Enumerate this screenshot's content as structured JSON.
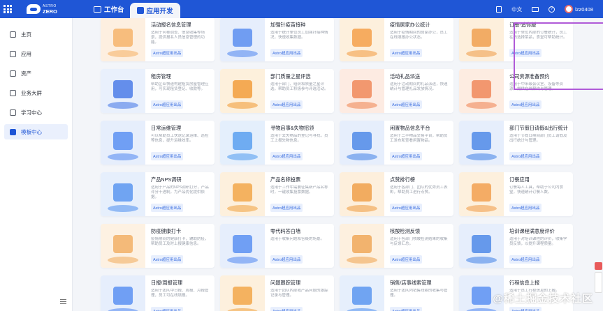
{
  "header": {
    "brand_top": "ASTRO",
    "brand_bottom": "ZERO",
    "tabs": [
      {
        "label": "工作台",
        "active": false
      },
      {
        "label": "应用开发",
        "active": true
      }
    ],
    "right": {
      "doc_label": "",
      "lang": "中文",
      "user": "lzz0408"
    }
  },
  "sidebar": {
    "items": [
      {
        "label": "主页",
        "icon": "home-icon",
        "active": false
      },
      {
        "label": "应用",
        "icon": "app-icon",
        "active": false
      },
      {
        "label": "资产",
        "icon": "asset-icon",
        "active": false
      },
      {
        "label": "业务大屏",
        "icon": "screen-icon",
        "active": false
      },
      {
        "label": "学习中心",
        "icon": "learn-icon",
        "active": false
      },
      {
        "label": "模板中心",
        "icon": "template-icon",
        "active": true
      }
    ]
  },
  "cards": [
    {
      "title": "活动报名信息管理",
      "desc": "适用于问卷调查、信息收集等场景，提供报名人员信息管理的功能。",
      "tag": "Astro超应用出品",
      "color": "#f6b46b",
      "bg": "#fdefe0"
    },
    {
      "title": "加强针疫苗接种",
      "desc": "适用于统计单位员工加强针接种情况，快速收集数据。",
      "tag": "Astro超应用出品",
      "color": "#5a8ef0",
      "bg": "#e6eefc"
    },
    {
      "title": "疫情居家办公统计",
      "desc": "适用于疫情期间的居家办公，员工在线填报办公状态。",
      "tag": "Astro超应用出品",
      "color": "#f4a04a",
      "bg": "#fdf0dd"
    },
    {
      "title": "订餐-追你版",
      "desc": "适用于单位内部的订餐统计，员工在线选择菜品，食堂可帮助统计。",
      "tag": "Astro超应用出品",
      "color": "#f0a050",
      "bg": "#fdefdc"
    },
    {
      "title": "租房管理",
      "desc": "帮助企业快速构建租赁房屋管理应用，可实现租赁登记、收款等。",
      "tag": "Astro超应用出品",
      "color": "#4c7de8",
      "bg": "#e9f0fc"
    },
    {
      "title": "部门质量之星评选",
      "desc": "适用于部门、组织和质量之星评选，帮助员工积极参与评选活动。",
      "tag": "Astro超应用出品",
      "color": "#f29e3c",
      "bg": "#fdf0dc"
    },
    {
      "title": "活动礼品派送",
      "desc": "适用于活动期间的礼品派送，快速统计与管理礼品发放情况。",
      "tag": "Astro超应用出品",
      "color": "#f08a5a",
      "bg": "#fdebe2"
    },
    {
      "title": "公司资源准备预约",
      "desc": "适用于中米级会议室、设备等资源，提供在线预约与管理。",
      "tag": "Astro超应用出品",
      "color": "#f0885a",
      "bg": "#fdece1"
    },
    {
      "title": "日常运维管理",
      "desc": "可以帮助员工快速记录运维、巡检等信息，提升运维效率。",
      "tag": "Astro超应用出品",
      "color": "#5b90f2",
      "bg": "#e6eefc"
    },
    {
      "title": "寻物启事&失物招领",
      "desc": "适用于丢失物品的登记与寻找，员工上报失物信息。",
      "tag": "Astro超应用出品",
      "color": "#5aa0f0",
      "bg": "#e4effc"
    },
    {
      "title": "闲置物品信息平台",
      "desc": "适用于二手物品交易平台，帮助员工发布和查看闲置物品。",
      "tag": "Astro超应用出品",
      "color": "#4f8ae8",
      "bg": "#e6eefc"
    },
    {
      "title": "部门节假日请假&出行统计",
      "desc": "适用于节假日期间部门员工请假及出行统计与管理。",
      "tag": "Astro超应用出品",
      "color": "#4f8ae8",
      "bg": "#e6eefc"
    },
    {
      "title": "产品NPS调研",
      "desc": "适用于产品的NPS调研打分，产品评分十进制，为产品优化提供依据。",
      "tag": "Astro超应用出品",
      "color": "#5a96f0",
      "bg": "#e6effc"
    },
    {
      "title": "产品名称投票",
      "desc": "适用于工作中需要征集新产品名称时，一键收集投票数据。",
      "tag": "Astro超应用出品",
      "color": "#f2a74a",
      "bg": "#fdf0dd"
    },
    {
      "title": "点赞排行榜",
      "desc": "适用于各部门、团队的优秀员工表彰，帮助员工进行点赞。",
      "tag": "Astro超应用出品",
      "color": "#f0a04a",
      "bg": "#fdefdc"
    },
    {
      "title": "订餐应用",
      "desc": "订餐每人工具，帮助于公司内食堂，快速统计订餐人数。",
      "tag": "Astro超应用出品",
      "color": "#f2a050",
      "bg": "#fdf0dd"
    },
    {
      "title": "防疫健康打卡",
      "desc": "疫情期间的健康打卡，辅助防疫，帮助员工及时上报健康信息。",
      "tag": "Astro超应用出品",
      "color": "#f2b066",
      "bg": "#fdf1e2"
    },
    {
      "title": "零代码答白墙",
      "desc": "适用于收集问题和答疑的场景。",
      "tag": "Astro超应用出品",
      "color": "#5b90f2",
      "bg": "#e6eefc"
    },
    {
      "title": "核酸检测反馈",
      "desc": "适用于各部门核酸检测结果的收集与反馈汇总。",
      "tag": "Astro超应用出品",
      "color": "#f0a85a",
      "bg": "#fdf0df"
    },
    {
      "title": "培训课程满意度评价",
      "desc": "适用于对培训课程的评价，收集学员反馈，以提升课程质量。",
      "tag": "Astro超应用出品",
      "color": "#4f8ae8",
      "bg": "#e6eefc"
    },
    {
      "title": "日报/周报管理",
      "desc": "适用于团队中日报、周报、月报管理，员工可在线填报。",
      "tag": "Astro超应用出品",
      "color": "#5b90f2",
      "bg": "#e6eefc"
    },
    {
      "title": "问题跟踪管理",
      "desc": "适用于团队内部或产品问题的跟踪记录与管理。",
      "tag": "Astro超应用出品",
      "color": "#f2a74a",
      "bg": "#fdf0dd"
    },
    {
      "title": "销售/店事线索管理",
      "desc": "适用于团队内销售线索的收集与管理。",
      "tag": "Astro超应用出品",
      "color": "#5a96f0",
      "bg": "#e6effc"
    },
    {
      "title": "行程信息上报",
      "desc": "适用于员工行程信息的上报。",
      "tag": "Astro超应用出品",
      "color": "#5b90f2",
      "bg": "#e6eefc"
    }
  ],
  "watermark": "@稀土掘金技术社区"
}
